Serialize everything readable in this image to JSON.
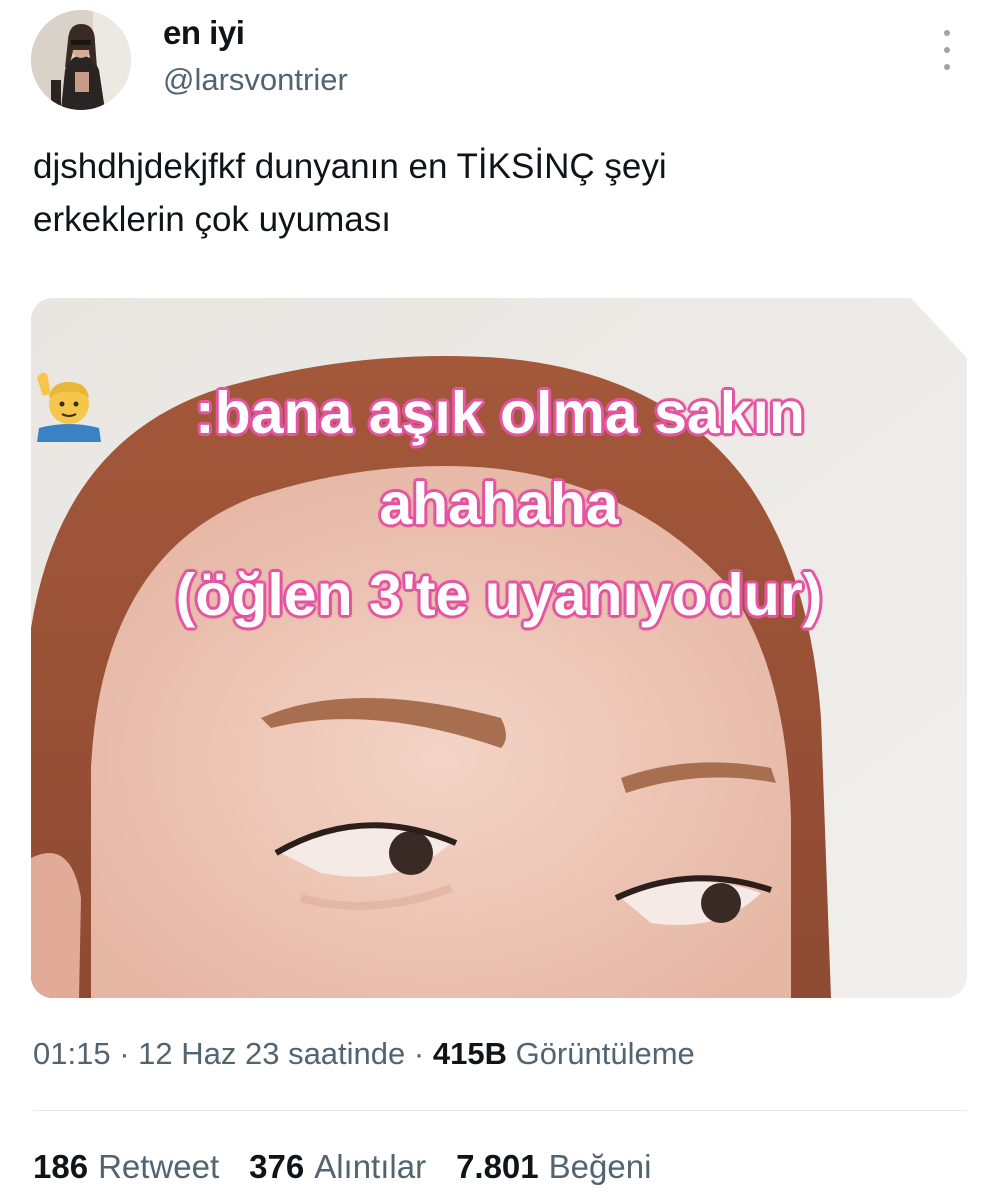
{
  "author": {
    "display_name": "en iyi",
    "handle": "@larsvontrier"
  },
  "tweet": {
    "text_line1": "djshdhjdekjfkf dunyanın en TİKSİNÇ şeyi",
    "text_line2": "erkeklerin çok uyuması"
  },
  "media": {
    "overlay_emoji": "man-raising-hand-icon",
    "overlay_line1": ":bana aşık olma sakın",
    "overlay_line2": "ahahaha",
    "overlay_line3": "(öğlen 3'te uyanıyodur)"
  },
  "meta": {
    "time": "01:15",
    "sep1": " · ",
    "date": "12 Haz 23 saatinde",
    "sep2": " · ",
    "views_count": "415B",
    "views_label": "Görüntüleme"
  },
  "stats": {
    "retweets_count": "186",
    "retweets_label": "Retweet",
    "quotes_count": "376",
    "quotes_label": "Alıntılar",
    "likes_count": "7.801",
    "likes_label": "Beğeni"
  },
  "colors": {
    "text_primary": "#0f1419",
    "text_secondary": "#536471",
    "overlay_pink": "#e060a4"
  }
}
